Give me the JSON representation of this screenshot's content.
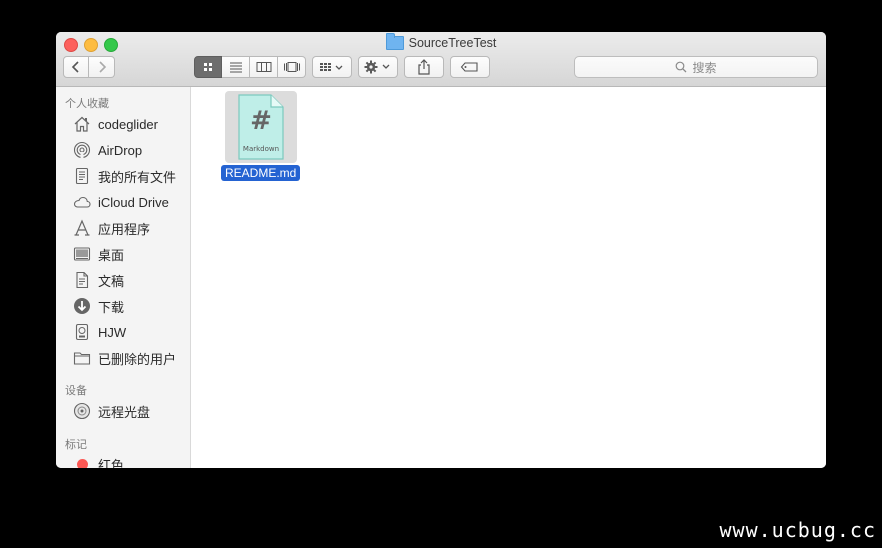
{
  "window": {
    "title": "SourceTreeTest"
  },
  "toolbar": {
    "search_placeholder": "搜索"
  },
  "sidebar": {
    "favorites_header": "个人收藏",
    "favorites": [
      {
        "label": "codeglider",
        "icon": "home-icon"
      },
      {
        "label": "AirDrop",
        "icon": "airdrop-icon"
      },
      {
        "label": "我的所有文件",
        "icon": "all-files-icon"
      },
      {
        "label": "iCloud Drive",
        "icon": "cloud-icon"
      },
      {
        "label": "应用程序",
        "icon": "applications-icon"
      },
      {
        "label": "桌面",
        "icon": "desktop-icon"
      },
      {
        "label": "文稿",
        "icon": "documents-icon"
      },
      {
        "label": "下载",
        "icon": "downloads-icon"
      },
      {
        "label": "HJW",
        "icon": "disk-icon"
      },
      {
        "label": "已删除的用户",
        "icon": "folder-icon"
      }
    ],
    "devices_header": "设备",
    "devices": [
      {
        "label": "远程光盘",
        "icon": "remote-disc-icon"
      }
    ],
    "tags_header": "标记",
    "tags": [
      {
        "label": "红色",
        "color": "#fc5753"
      }
    ]
  },
  "files": [
    {
      "name": "README.md",
      "icon_text": "#",
      "icon_caption": "Markdown"
    }
  ],
  "watermark": "www.ucbug.cc"
}
